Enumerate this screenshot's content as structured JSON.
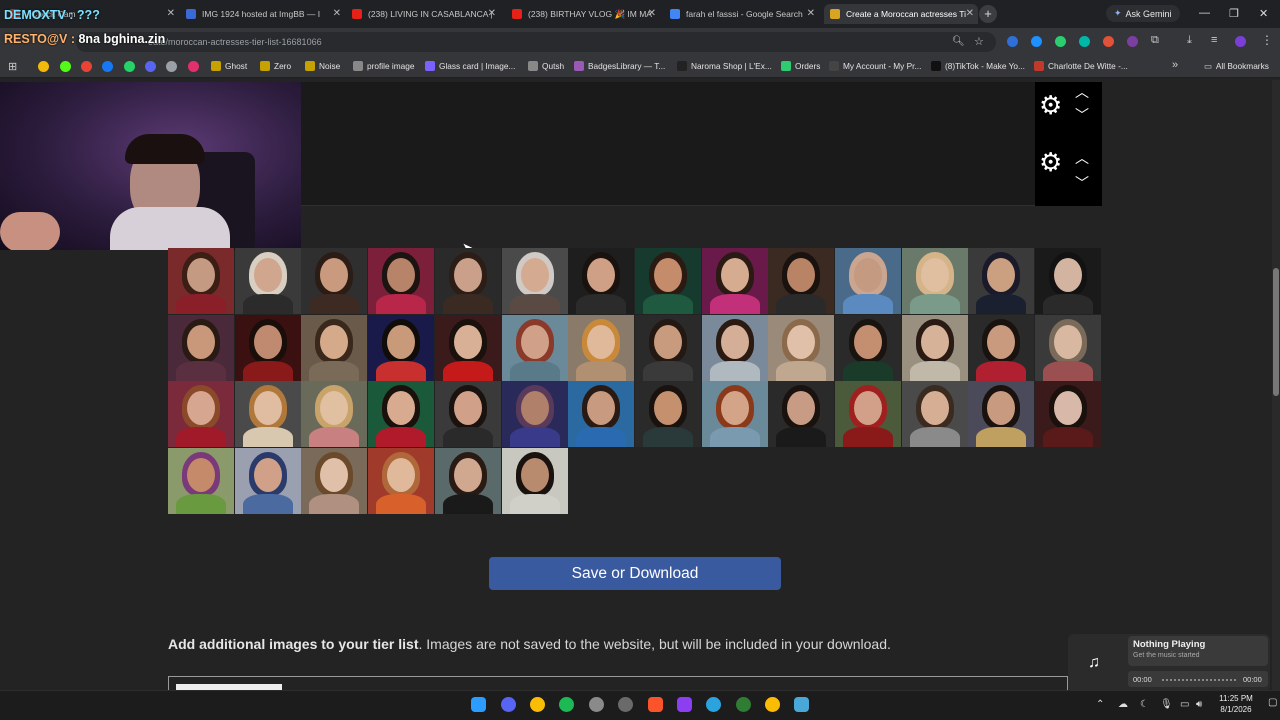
{
  "stream": {
    "title_line1": "DEMOXTV : ???",
    "title_line2_prefix": "RESTO@V : ",
    "title_line2_suffix": "8na bghina.zin"
  },
  "tabs": [
    {
      "label": "- Check Cam",
      "active": false,
      "favicon": "#c0392b"
    },
    {
      "label": "IMG 1924 hosted at ImgBB — I",
      "active": false,
      "favicon": "#3b6ad6"
    },
    {
      "label": "(238) LIVING IN CASABLANCA |",
      "active": false,
      "favicon": "#e62117"
    },
    {
      "label": "(238) BIRTHAY VLOG 🎉 IM MA",
      "active": false,
      "favicon": "#e62117"
    },
    {
      "label": "farah el fasssi - Google Search",
      "active": false,
      "favicon": "#4285f4"
    },
    {
      "label": "Create a Moroccan actresses Ti",
      "active": true,
      "favicon": "#d9a520"
    }
  ],
  "toolbar": {
    "new_tab": "+",
    "ask_gemini": "Ask Gemini",
    "url": "eate/moroccan-actresses-tier-list-16681066"
  },
  "bookmarks": [
    {
      "label": "Ghost",
      "color": "#c6a200"
    },
    {
      "label": "Zero",
      "color": "#c6a200"
    },
    {
      "label": "Noise",
      "color": "#c6a200"
    },
    {
      "label": "profile image",
      "color": "#888888"
    },
    {
      "label": "Glass card | Image...",
      "color": "#7b61ff"
    },
    {
      "label": "Qutsh",
      "color": "#888888"
    },
    {
      "label": "BadgesLibrary — T...",
      "color": "#9b59b6"
    },
    {
      "label": "Naroma Shop | L'Ex...",
      "color": "#222222"
    },
    {
      "label": "Orders",
      "color": "#2ecc71"
    },
    {
      "label": "My Account - My Pr...",
      "color": "#444444"
    },
    {
      "label": "(8)TikTok - Make Yo...",
      "color": "#111111"
    },
    {
      "label": "Charlotte De Witte -...",
      "color": "#c0392b"
    }
  ],
  "all_bookmarks": "All Bookmarks",
  "page": {
    "save_button": "Save or Download",
    "add_images_bold": "Add additional images to your tier list",
    "add_images_rest": ". Images are not saved to the website, but will be included in your download."
  },
  "music": {
    "title": "Nothing Playing",
    "subtitle": "Get the music started",
    "time_start": "00:00",
    "time_end": "00:00"
  },
  "clock": {
    "time": "11:25 PM",
    "date": "8/1/2026"
  },
  "thumbnails": [
    [
      "#7a2a2a",
      "#3b1e14",
      "#c49a82",
      "#8a1f2a"
    ],
    [
      "#3a3a3a",
      "#d8cfc2",
      "#d0a68e",
      "#2b2b2b"
    ],
    [
      "#2f2f2f",
      "#2b1d16",
      "#c99a7e",
      "#3d2a22"
    ],
    [
      "#7c1f3a",
      "#1b1410",
      "#b7846a",
      "#b8264a"
    ],
    [
      "#2a2a2a",
      "#2c1e16",
      "#caa08a",
      "#3a2a22"
    ],
    [
      "#4a4a4a",
      "#cfcac5",
      "#d4ab90",
      "#5a4a44"
    ],
    [
      "#1e1e1e",
      "#1a120e",
      "#cfa086",
      "#2b2b2b"
    ],
    [
      "#173a2e",
      "#2a1a12",
      "#c48c6a",
      "#1f5a40"
    ],
    [
      "#6a1a4a",
      "#2a1a14",
      "#d6ac90",
      "#c2307a"
    ],
    [
      "#3a2a22",
      "#1a120e",
      "#b98466",
      "#2a2a2a"
    ],
    [
      "#4a6a8a",
      "#caa690",
      "#c49a80",
      "#5a8abf"
    ],
    [
      "#6a7a6a",
      "#d6b48a",
      "#e0bea0",
      "#7a9a8a"
    ],
    [
      "#3a3a3a",
      "#1a1a2a",
      "#caa080",
      "#1a2030"
    ],
    [
      "#1a1a1a",
      "#121212",
      "#d2b4a0",
      "#2a2a2a"
    ],
    [
      "#4a2a3a",
      "#2a1a14",
      "#c9987a",
      "#5a3040"
    ],
    [
      "#3a1010",
      "#1a0e0a",
      "#c08a70",
      "#8a1a1a"
    ],
    [
      "#6a5a4a",
      "#3a281c",
      "#d4aa8a",
      "#7a6a58"
    ],
    [
      "#1a1a4a",
      "#100c0a",
      "#c99a7a",
      "#c83030"
    ],
    [
      "#3a1a1a",
      "#1a100c",
      "#d8b096",
      "#c41a1a"
    ],
    [
      "#6a8a9a",
      "#8a3a2a",
      "#d0a088",
      "#5a7a8a"
    ],
    [
      "#8a7a6a",
      "#c88a3a",
      "#e0b89a",
      "#b09070"
    ],
    [
      "#2a2a2a",
      "#241812",
      "#c89a7e",
      "#3a3a3a"
    ],
    [
      "#7a8a9a",
      "#2a1a12",
      "#d4ae96",
      "#b0b8c0"
    ],
    [
      "#9a8a7a",
      "#8a6a4a",
      "#e0c0a8",
      "#c0a890"
    ],
    [
      "#2a2a2a",
      "#1a1410",
      "#c48e70",
      "#1a3a2a"
    ],
    [
      "#9a9080",
      "#2a1a14",
      "#d6b298",
      "#c0b8a8"
    ],
    [
      "#2a2a2a",
      "#1a120e",
      "#c99a7e",
      "#b02030"
    ],
    [
      "#3a3a3a",
      "#7a6a5a",
      "#d8b8a0",
      "#9a5050"
    ],
    [
      "#7a2a3a",
      "#8a4a2a",
      "#d6a690",
      "#a01a2a"
    ],
    [
      "#4a4a4a",
      "#b0783a",
      "#e0bca0",
      "#d8c8b0"
    ],
    [
      "#6a6a5a",
      "#c8a46a",
      "#e0c0a0",
      "#c88080"
    ],
    [
      "#1a5a3a",
      "#1a100c",
      "#d8aa90",
      "#b01a2a"
    ],
    [
      "#3a3a3a",
      "#1a120e",
      "#d0a088",
      "#2a2a2a"
    ],
    [
      "#2a2a5a",
      "#5a3a5a",
      "#b0806a",
      "#3a3a8a"
    ],
    [
      "#2a6aa0",
      "#2a1a14",
      "#c89a80",
      "#2a6ab0"
    ],
    [
      "#2a2a2a",
      "#1a120e",
      "#c4906e",
      "#2a3a3a"
    ],
    [
      "#6a8a9a",
      "#8a3a1a",
      "#d4a488",
      "#7a9ab0"
    ],
    [
      "#2a2a2a",
      "#1a120e",
      "#c89c84",
      "#1a1a1a"
    ],
    [
      "#4a5a3a",
      "#a02020",
      "#d2a088",
      "#8a1a1a"
    ],
    [
      "#4a4a4a",
      "#3a2a20",
      "#d6ae94",
      "#8a8a8a"
    ],
    [
      "#4a4a5a",
      "#1a120e",
      "#c89a80",
      "#c0a060"
    ],
    [
      "#3a1a1a",
      "#1a100c",
      "#d8b8a8",
      "#5a1a1a"
    ],
    [
      "#8a9a6a",
      "#7a3a7a",
      "#c48a6a",
      "#6a9a40"
    ],
    [
      "#9aa0b0",
      "#2a3a6a",
      "#d0a088",
      "#4a6aa0"
    ],
    [
      "#7a6a5a",
      "#6a4a2a",
      "#e0c0a8",
      "#b09080"
    ],
    [
      "#a03a2a",
      "#b0683a",
      "#e0b89a",
      "#d8602a"
    ],
    [
      "#5a6a6a",
      "#2a1a14",
      "#d0a890",
      "#1a1a1a"
    ],
    [
      "#c8c8c0",
      "#1a120e",
      "#b88a6e",
      "#d0d0c8"
    ]
  ]
}
